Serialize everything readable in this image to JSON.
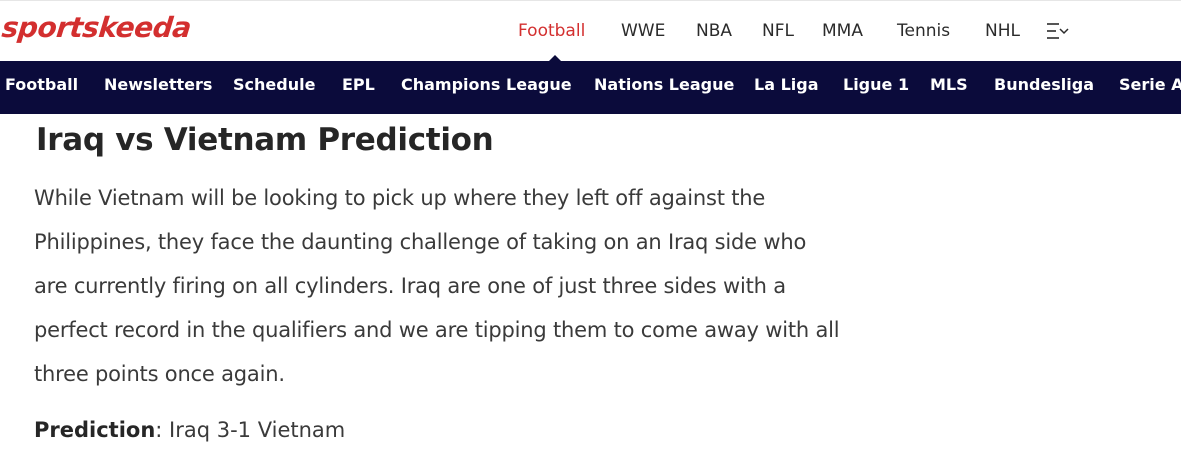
{
  "header": {
    "logo_text": "sportskeeda",
    "brand_color": "#d32f2f",
    "nav": [
      {
        "label": "Football",
        "active": true
      },
      {
        "label": "WWE"
      },
      {
        "label": "NBA"
      },
      {
        "label": "NFL"
      },
      {
        "label": "MMA"
      },
      {
        "label": "Tennis"
      },
      {
        "label": "NHL"
      }
    ],
    "menu_icon": "menu-expand-icon"
  },
  "subnav": {
    "background": "#0b0b3b",
    "items": [
      {
        "label": "Football"
      },
      {
        "label": "Newsletters"
      },
      {
        "label": "Schedule"
      },
      {
        "label": "EPL"
      },
      {
        "label": "Champions League"
      },
      {
        "label": "Nations League"
      },
      {
        "label": "La Liga"
      },
      {
        "label": "Ligue 1"
      },
      {
        "label": "MLS"
      },
      {
        "label": "Bundesliga"
      },
      {
        "label": "Serie A"
      }
    ]
  },
  "article": {
    "headline": "Iraq vs Vietnam Prediction",
    "paragraph": "While Vietnam will be looking to pick up where they left off against the Philippines, they face the daunting challenge of taking on an Iraq side who are currently firing on all cylinders. Iraq are one of just three sides with a perfect record in the qualifiers and we are tipping them to come away with all three points once again.",
    "prediction_label": "Prediction",
    "prediction_value": ": Iraq 3-1 Vietnam"
  }
}
